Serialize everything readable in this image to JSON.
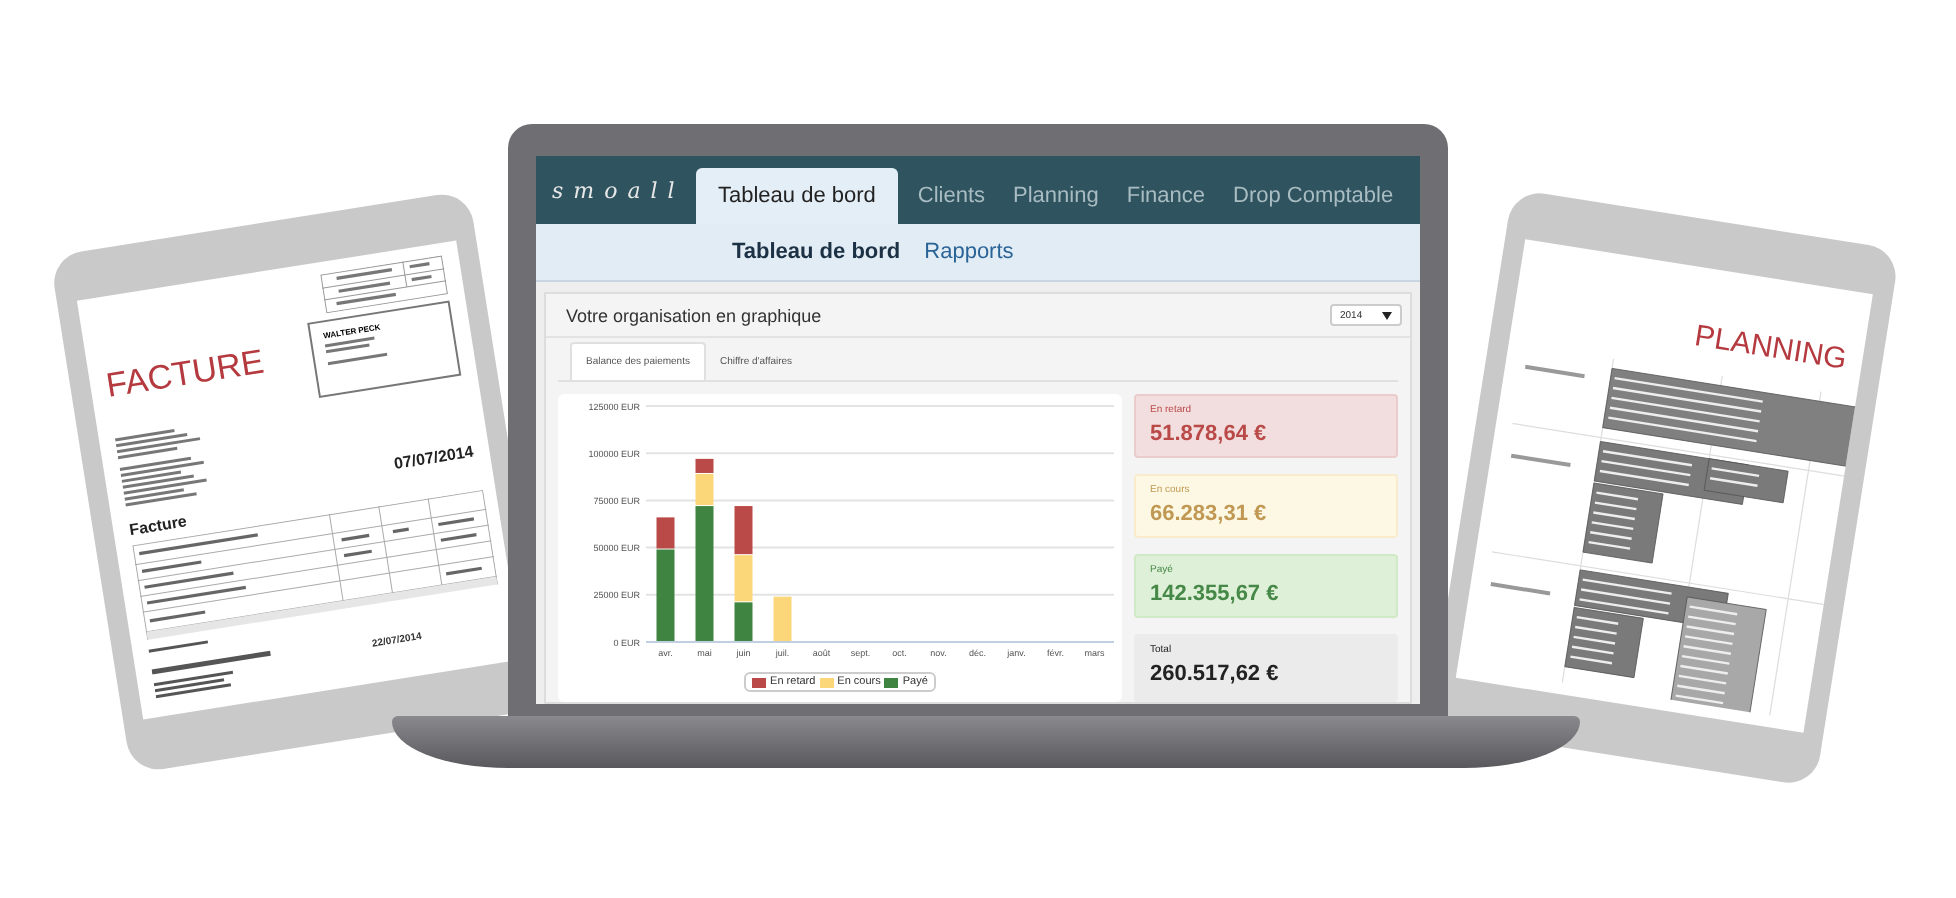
{
  "invoice_tablet": {
    "heading": "FACTURE",
    "client": "WALTER PECK",
    "date": "07/07/2014",
    "title": "Facture",
    "due_date": "22/07/2014"
  },
  "laptop": {
    "logo": "smoall",
    "nav_tabs": [
      {
        "label": "Tableau de bord",
        "selected": true
      },
      {
        "label": "Clients",
        "selected": false
      },
      {
        "label": "Planning",
        "selected": false
      },
      {
        "label": "Finance",
        "selected": false
      },
      {
        "label": "Drop Comptable",
        "selected": false
      }
    ],
    "sub_tabs": [
      {
        "label": "Tableau de bord",
        "selected": true
      },
      {
        "label": "Rapports",
        "selected": false
      }
    ],
    "panel": {
      "title": "Votre organisation en graphique",
      "year_select": {
        "value": "2014"
      },
      "tabs": [
        {
          "label": "Balance des paiements",
          "selected": true
        },
        {
          "label": "Chiffre d'affaires",
          "selected": false
        }
      ],
      "chart_data": {
        "type": "bar",
        "stacked": true,
        "categories": [
          "avr.",
          "mai",
          "juin",
          "juil.",
          "août",
          "sept.",
          "oct.",
          "nov.",
          "déc.",
          "janv.",
          "févr.",
          "mars"
        ],
        "ylim": [
          0,
          125000
        ],
        "grid": true,
        "legend": true,
        "yticks": [
          {
            "value": 0,
            "label": "0 EUR"
          },
          {
            "value": 25000,
            "label": "25000 EUR"
          },
          {
            "value": 50000,
            "label": "50000 EUR"
          },
          {
            "value": 75000,
            "label": "75000 EUR"
          },
          {
            "value": 100000,
            "label": "100000 EUR"
          },
          {
            "value": 125000,
            "label": "125000 EUR"
          }
        ],
        "series": [
          {
            "name": "En retard",
            "color": "#b94a48",
            "values": [
              17000,
              8000,
              26000,
              0,
              0,
              0,
              0,
              0,
              0,
              0,
              0,
              0
            ]
          },
          {
            "name": "En cours",
            "color": "#fcd77a",
            "values": [
              0,
              17000,
              25000,
              24000,
              0,
              0,
              0,
              0,
              0,
              0,
              0,
              0
            ]
          },
          {
            "name": "Payé",
            "color": "#3f8541",
            "values": [
              49000,
              72000,
              21000,
              0,
              0,
              0,
              0,
              0,
              0,
              0,
              0,
              0
            ]
          }
        ]
      },
      "summary_cards": [
        {
          "kind": "late",
          "label": "En retard",
          "value": "51.878,64 €"
        },
        {
          "kind": "pending",
          "label": "En cours",
          "value": "66.283,31 €"
        },
        {
          "kind": "paid",
          "label": "Payé",
          "value": "142.355,67 €"
        },
        {
          "kind": "total",
          "label": "Total",
          "value": "260.517,62 €"
        }
      ]
    }
  },
  "planning_tablet": {
    "heading": "PLANNING"
  }
}
